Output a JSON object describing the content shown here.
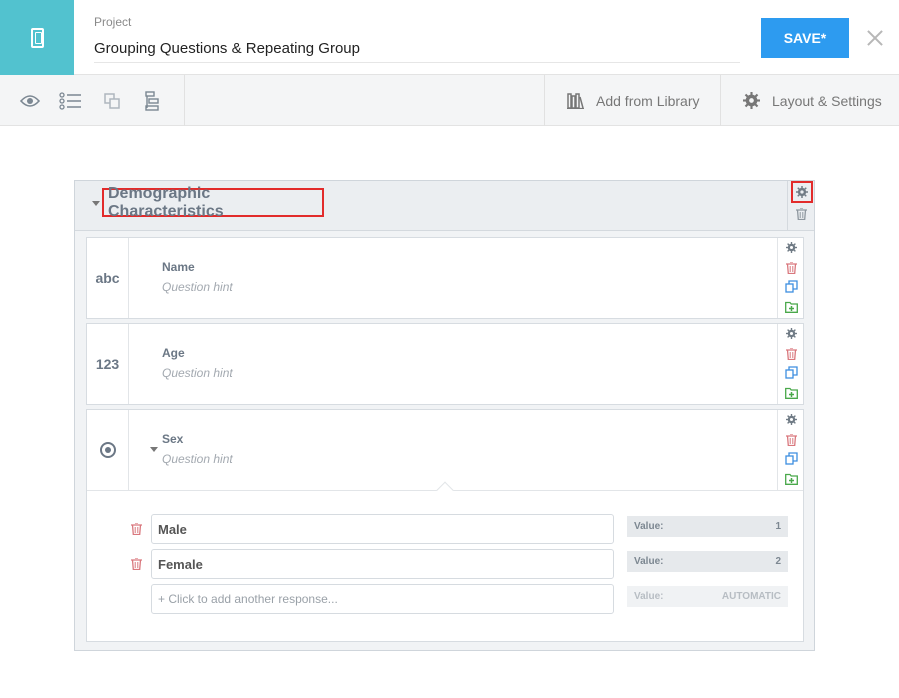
{
  "header": {
    "project_label": "Project",
    "project_name": "Grouping Questions & Repeating Group",
    "save_label": "SAVE*"
  },
  "toolbar": {
    "add_from_library": "Add from Library",
    "layout_settings": "Layout & Settings"
  },
  "group": {
    "title": "Demographic Characteristics"
  },
  "questions": [
    {
      "type_label": "abc",
      "title": "Name",
      "hint": "Question hint"
    },
    {
      "type_label": "123",
      "title": "Age",
      "hint": "Question hint"
    },
    {
      "type_label": "",
      "title": "Sex",
      "hint": "Question hint"
    }
  ],
  "responses": [
    {
      "label": "Male",
      "value_label": "Value:",
      "value": "1"
    },
    {
      "label": "Female",
      "value_label": "Value:",
      "value": "2"
    }
  ],
  "add_response": {
    "placeholder": "+ Click to add another response...",
    "value_label": "Value:",
    "value": "AUTOMATIC"
  },
  "colors": {
    "accent": "#52c2cf",
    "save": "#2d9bf0",
    "highlight": "#e22b2b",
    "trash": "#d9777d",
    "copy": "#3d8ee0",
    "folder": "#49a84a"
  }
}
